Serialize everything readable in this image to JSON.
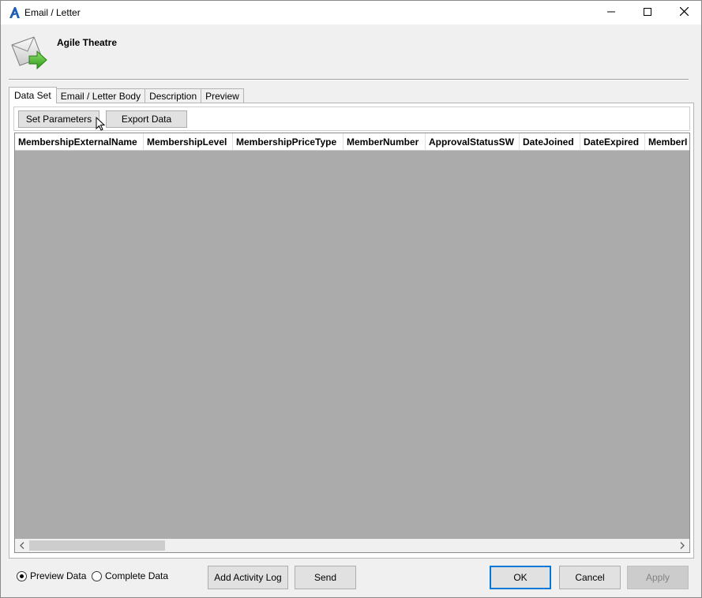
{
  "window": {
    "title": "Email / Letter",
    "icon": "agile-logo-icon",
    "controls": [
      "minimize-icon",
      "maximize-icon",
      "close-icon"
    ]
  },
  "header": {
    "organization": "Agile Theatre",
    "icon": "email-send-icon"
  },
  "tabs": [
    {
      "label": "Data Set",
      "active": true
    },
    {
      "label": "Email / Letter Body",
      "active": false
    },
    {
      "label": "Description",
      "active": false
    },
    {
      "label": "Preview",
      "active": false
    }
  ],
  "toolbar": {
    "set_parameters_label": "Set Parameters",
    "export_data_label": "Export Data"
  },
  "grid": {
    "columns": [
      "MembershipExternalName",
      "MembershipLevel",
      "MembershipPriceType",
      "MemberNumber",
      "ApprovalStatusSW",
      "DateJoined",
      "DateExpired",
      "MemberI"
    ],
    "rows": []
  },
  "data_mode": {
    "preview_label": "Preview Data",
    "complete_label": "Complete Data",
    "selected": "preview"
  },
  "buttons": {
    "add_activity_log": "Add Activity Log",
    "send": "Send",
    "ok": "OK",
    "cancel": "Cancel",
    "apply": "Apply"
  },
  "colors": {
    "grid_background": "#ababab",
    "accent": "#0078d7",
    "window_background": "#f0f0f0"
  }
}
